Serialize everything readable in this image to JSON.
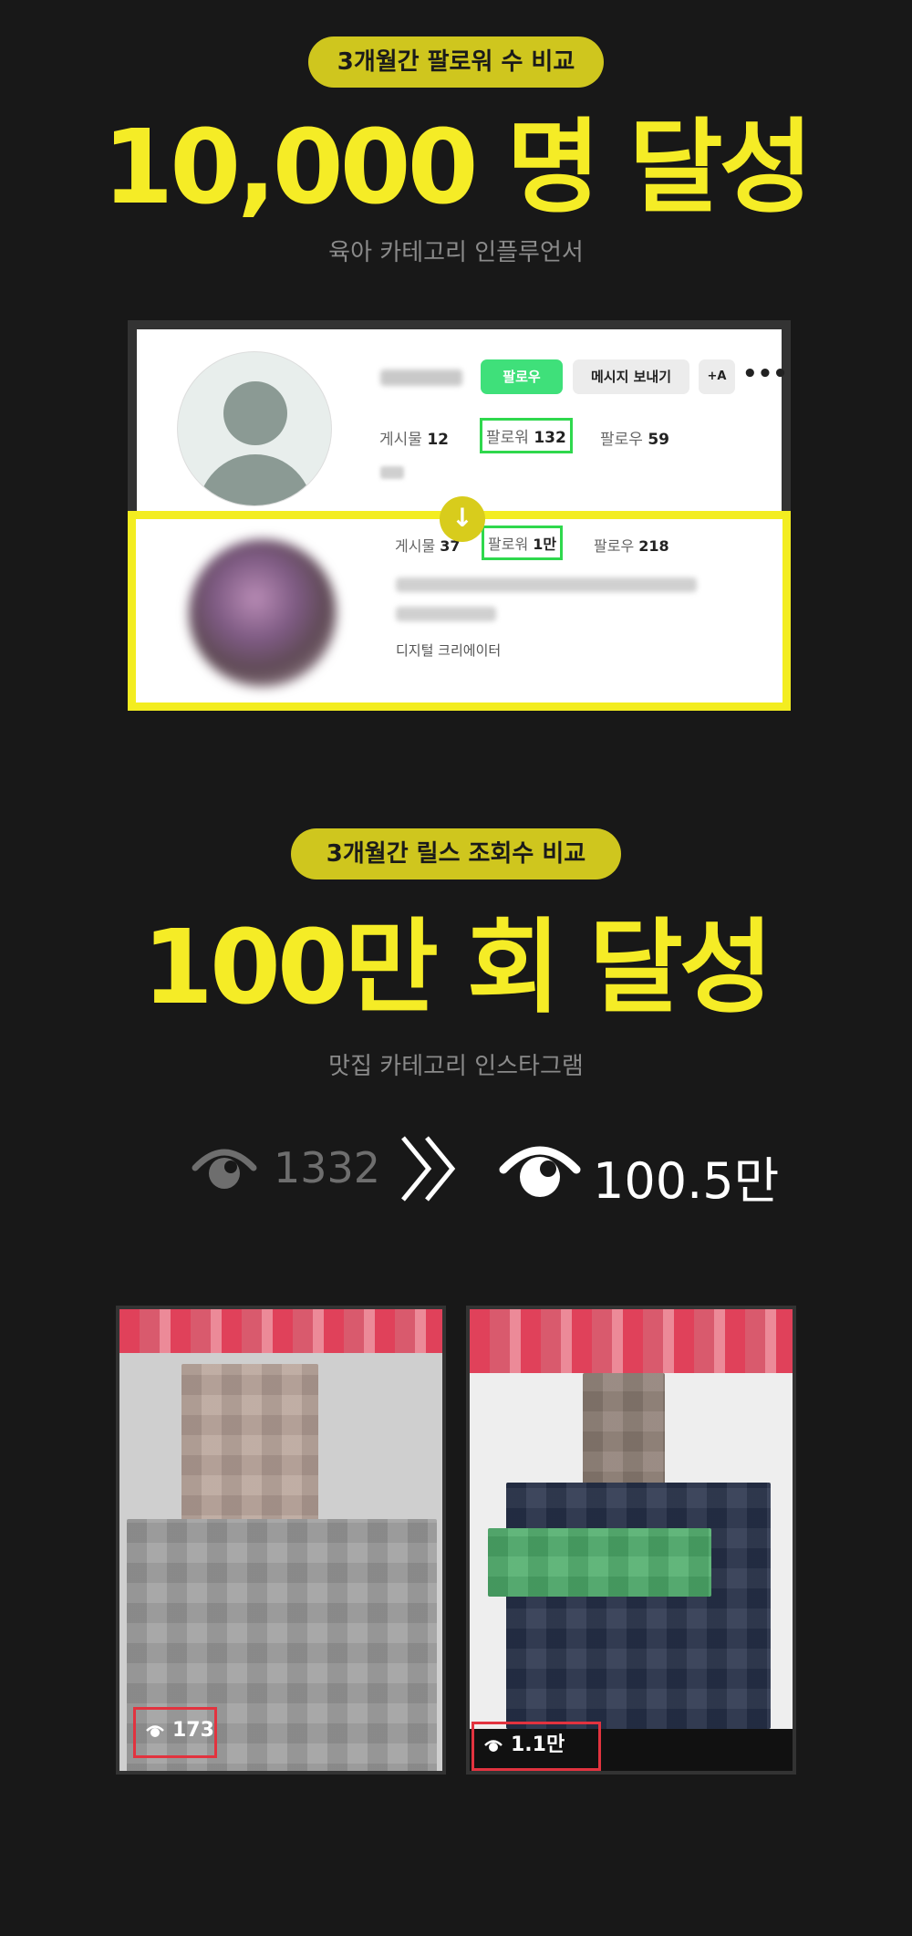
{
  "section1": {
    "pill": "3개월간 팔로워 수 비교",
    "headline": "10,000 명 달성",
    "subline": "육아 카테고리 인플루언서"
  },
  "profile_before": {
    "follow_label": "팔로우",
    "message_label": "메시지 보내기",
    "add_label": "+A",
    "more_label": "•••",
    "posts_label": "게시물",
    "posts_value": "12",
    "followers_label": "팔로워",
    "followers_value": "132",
    "following_label": "팔로우",
    "following_value": "59"
  },
  "profile_after": {
    "arrow": "↓",
    "posts_label": "게시물",
    "posts_value": "37",
    "followers_label": "팔로워",
    "followers_value": "1만",
    "following_label": "팔로우",
    "following_value": "218",
    "category": "디지털 크리에이터"
  },
  "section2": {
    "pill": "3개월간 릴스 조회수 비교",
    "headline": "100만 회 달성",
    "subline": "맛집 카테고리 인스타그램"
  },
  "views": {
    "before": "1332",
    "after": "100.5만"
  },
  "reels": {
    "left_views": "173",
    "right_views": "1.1만"
  },
  "colors": {
    "accent_yellow": "#f5ec26",
    "pill_yellow": "#cfc61e",
    "follow_green": "#3fe07a",
    "highlight_green": "#2fd84d",
    "tag_red": "#e2333f"
  },
  "icons": {
    "views": "eye-icon",
    "transition": "double-chevron-right-icon",
    "step": "arrow-down-icon"
  }
}
